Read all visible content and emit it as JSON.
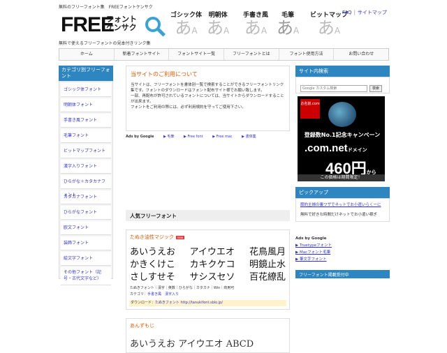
{
  "header": {
    "tagline": "無料のフリーフォント集　FREEフォントケンサク",
    "logo": {
      "free": "FREE",
      "kana1": "フォント",
      "kana2": "ケンサク"
    },
    "subtagline": "無料で使えるフリーフォントの見本付きリンク集",
    "styles": [
      {
        "name": "ゴシック体",
        "sample_big": "あ",
        "sample_small": "A"
      },
      {
        "name": "明朝体",
        "sample_big": "あ",
        "sample_small": "A"
      },
      {
        "name": "手書き風",
        "sample_big": "あ",
        "sample_small": "A"
      },
      {
        "name": "毛筆",
        "sample_big": "あ",
        "sample_small": "A"
      },
      {
        "name": "ビットマップ",
        "sample_big": "あ",
        "sample_small": "A"
      }
    ],
    "links": {
      "faq": "FAQ",
      "sitemap": "サイトマップ"
    }
  },
  "nav": [
    "ホーム",
    "新着フォントサイト",
    "フォントサイト一覧",
    "フリーフォントとは",
    "フォント使用方法",
    "お問い合わせ"
  ],
  "left": {
    "title": "カテゴリ別フリーフォント",
    "items": [
      "ゴシック体フォント",
      "明朝体フォント",
      "手書き風フォント",
      "毛筆フォント",
      "ビットマップフォント",
      "漢字入りフォント",
      "ひらがな＋カタカナフォント",
      "カタカナフォント",
      "ひらがなフォント",
      "欧文フォント",
      "装飾フォント",
      "絵文字フォント",
      "その他フォント（記号・古代文字など）"
    ]
  },
  "main": {
    "about_title": "当サイトのご利用について",
    "about_text": [
      "当サイトは、フリーフォントを書体別一覧で検索することができるフリーフォントリンク集です。フォントのダウンロードはフォント配布サイト様でお願い致します。",
      "一部、再配布が許可されているフォントについては、当サイトからダウンロードすることが出来ます。",
      "フォントをご利用の際には、必ず利用規約を守ってご使用下さい。"
    ],
    "ads_label": "Ads by Google",
    "ads": [
      "▶ 毛筆",
      "▶ Free font",
      "▶ Free mac",
      "▶ 書体集"
    ],
    "popular_title": "人気フリーフォント",
    "font1": {
      "name": "たぬき油性マジック",
      "badge": "new",
      "samples": [
        [
          "あいうえお",
          "かきくけこ",
          "さしすせそ"
        ],
        [
          "アイウエオ",
          "カキクケコ",
          "サシスセソ"
        ],
        [
          "花鳥風月",
          "明鏡止水",
          "百花繚乱"
        ]
      ],
      "meta_line1": "たぬきフォント｜漢字｜英数｜ひらがな｜カタカナ｜Win｜商用可",
      "meta_line2_label": "カテゴリ：",
      "meta_line2_links": [
        "手書き風",
        "漢字入り"
      ],
      "download_label": "ダウンロード：",
      "download_link": "たぬきフォント http://tanukifont.sblo.jp/"
    },
    "font2": {
      "name": "あんずもじ",
      "sample": "あいうえお アイウエオ ABCD"
    }
  },
  "right": {
    "search_title": "サイト内検索",
    "search_placeholder": "Google カスタム検索",
    "search_button": "検索",
    "banner": {
      "badge": "お名前.com",
      "line1": "登録数No.1記念キャンペーン",
      "line2": ".com.net",
      "line2_suffix": "ドメイン",
      "line3": "460円",
      "line3_suffix": "から",
      "line4": "この価格は期間限定！"
    },
    "pickup_title": "ピックアップ",
    "pickup_link": "節約主婦の裏ワザでネットでお小遣いらくーに",
    "pickup_text": "無料で好きな時間だけネットでお小遣い稼ぎ",
    "ads_label": "Ads by Google",
    "ads": [
      "▶ Truetypeフォント",
      "▶ Macフォント毛筆",
      "▶ 筆文字フォント"
    ],
    "bottom_title": "フリーフォント掲載受付中"
  }
}
